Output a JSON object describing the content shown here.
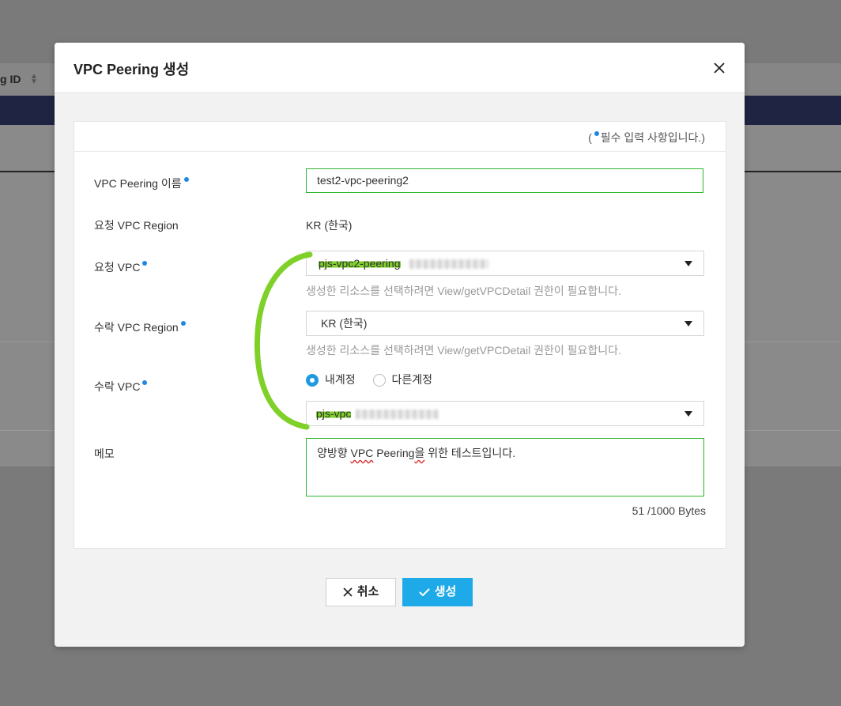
{
  "background": {
    "column_header": "g ID"
  },
  "modal": {
    "title": "VPC Peering 생성",
    "required_note_prefix": "(",
    "required_note_suffix": "필수 입력 사항입니다.)",
    "fields": {
      "name": {
        "label": "VPC Peering 이름",
        "value": "test2-vpc-peering2"
      },
      "request_region": {
        "label": "요청 VPC Region",
        "value": "KR (한국)"
      },
      "request_vpc": {
        "label": "요청 VPC",
        "value": "pjs-vpc2-peering",
        "helper": "생성한 리소스를 선택하려면 View/getVPCDetail 권한이 필요합니다."
      },
      "accept_region": {
        "label": "수락 VPC Region",
        "value": "KR (한국)",
        "helper": "생성한 리소스를 선택하려면 View/getVPCDetail 권한이 필요합니다."
      },
      "accept_vpc": {
        "label": "수락 VPC",
        "option_mine": "내계정",
        "option_other": "다른계정",
        "value": "pjs-vpc"
      },
      "memo": {
        "label": "메모",
        "value_part1": "양방향 ",
        "value_vpc": "VPC",
        "value_part2": " Peering",
        "value_part3": "을",
        "value_part4": " 위한 테스트입니다.",
        "byte_count": "51 /1000 Bytes"
      }
    },
    "buttons": {
      "cancel": "취소",
      "create": "생성"
    }
  },
  "colors": {
    "accent": "#1eaae8",
    "required_dot": "#1e88e5",
    "valid_border": "#2eb82e",
    "annotation": "#7fd12a"
  }
}
